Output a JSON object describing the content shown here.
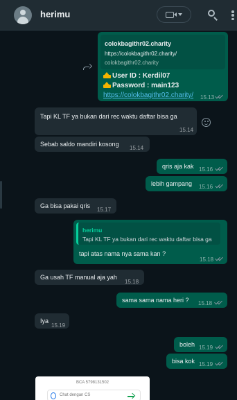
{
  "header": {
    "contact_name": "herimu"
  },
  "messages": {
    "m1": {
      "preview_title": "colokbagithr02.charity",
      "preview_url": "https://colokbagithr02.charity/",
      "preview_domain": "colokbagithr02.charity",
      "user_id": "User ID : Kerdil07",
      "password": "Password :  main123",
      "link": "https://colokbagithr02.charity/",
      "time": "15.13"
    },
    "m2": {
      "text": "Tapi KL TF ya bukan dari rec waktu daftar bisa ga",
      "time": "15.14"
    },
    "m3": {
      "text": "Sebab saldo mandiri kosong",
      "time": "15.14"
    },
    "m4": {
      "text": "qris aja kak",
      "time": "15.16"
    },
    "m5": {
      "text": "lebih gampang",
      "time": "15.16"
    },
    "m6": {
      "text": "Ga bisa pakai qris",
      "time": "15.17"
    },
    "m7": {
      "quote_author": "herimu",
      "quote_text": "Tapi KL TF ya bukan dari rec waktu daftar bisa ga",
      "text": "tapi atas nama nya sama kan ?",
      "time": "15.18"
    },
    "m8": {
      "text": "Ga usah TF manual aja yah",
      "time": "15.18"
    },
    "m9": {
      "text": "sama sama nama heri ?",
      "time": "15.18"
    },
    "m10": {
      "text": "Iya",
      "time": "15.19"
    },
    "m11": {
      "text": "boleh",
      "time": "15.19"
    },
    "m12": {
      "text": "bisa kok",
      "time": "15.19"
    },
    "m13": {
      "image_header": "BCA 5798131502",
      "image_cs_label": "Chat dengan CS"
    }
  },
  "icons": {
    "avatar": "default-avatar-icon",
    "video": "video-camera-icon",
    "dropdown": "chevron-down-icon",
    "search": "search-icon",
    "menu": "kebab-menu-icon",
    "forward": "forward-icon",
    "emoji": "emoji-icon",
    "read": "double-check-icon"
  },
  "colors": {
    "header_bg": "#202c33",
    "chat_bg": "#0b141a",
    "incoming_bubble": "#202c33",
    "outgoing_bubble": "#005c4b",
    "link": "#53bdeb",
    "quote_accent": "#06cf9c"
  }
}
